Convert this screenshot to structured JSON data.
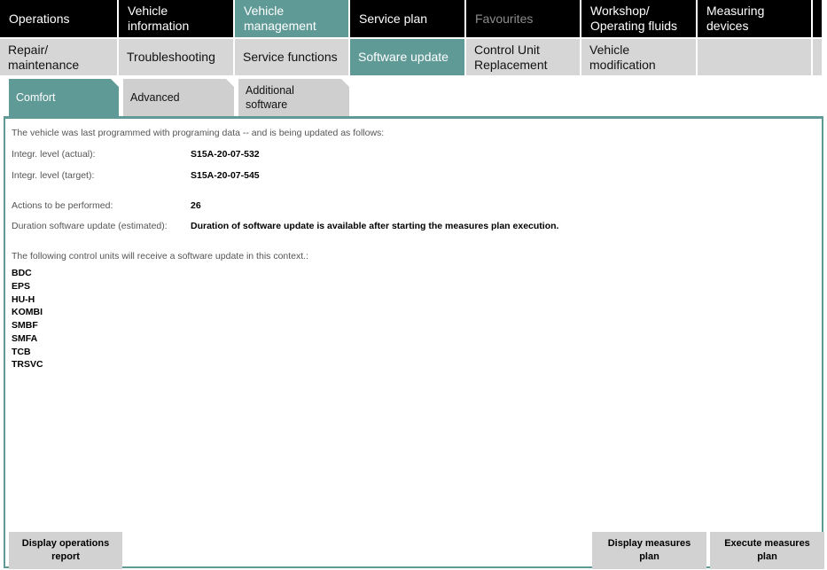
{
  "top_nav": [
    {
      "label": "Operations",
      "state": "normal"
    },
    {
      "label": "Vehicle information",
      "state": "normal"
    },
    {
      "label": "Vehicle management",
      "state": "active"
    },
    {
      "label": "Service plan",
      "state": "normal"
    },
    {
      "label": "Favourites",
      "state": "disabled"
    },
    {
      "label": "Workshop/ Operating fluids",
      "state": "normal"
    },
    {
      "label": "Measuring devices",
      "state": "normal"
    }
  ],
  "sub_nav": [
    {
      "label": "Repair/ maintenance"
    },
    {
      "label": "Troubleshooting"
    },
    {
      "label": "Service functions"
    },
    {
      "label": "Software update",
      "state": "active"
    },
    {
      "label": "Control Unit Replacement"
    },
    {
      "label": "Vehicle modification"
    },
    {
      "label": ""
    }
  ],
  "tabs": [
    {
      "label": "Comfort",
      "state": "active"
    },
    {
      "label": "Advanced"
    },
    {
      "label": "Additional software"
    }
  ],
  "content": {
    "intro": "The vehicle was last programmed with programing data -- and is being updated as follows:",
    "integr_actual_label": "Integr. level (actual):",
    "integr_actual_value": "S15A-20-07-532",
    "integr_target_label": "Integr. level (target):",
    "integr_target_value": "S15A-20-07-545",
    "actions_label": "Actions to be performed:",
    "actions_value": "26",
    "duration_label": "Duration software update (estimated):",
    "duration_value": "Duration of software update is available after starting the measures plan execution.",
    "control_units_heading": "The following control units will receive a software update in this context.:",
    "control_units": [
      "BDC",
      "EPS",
      "HU-H",
      "KOMBI",
      "SMBF",
      "SMFA",
      "TCB",
      "TRSVC"
    ]
  },
  "buttons": {
    "display_operations_report": "Display operations report",
    "display_measures_plan": "Display measures plan",
    "execute_measures_plan": "Execute measures plan"
  },
  "colors": {
    "accent": "#5f9a96",
    "nav_bg": "#000000",
    "subnav_bg": "#d6d6d6"
  }
}
